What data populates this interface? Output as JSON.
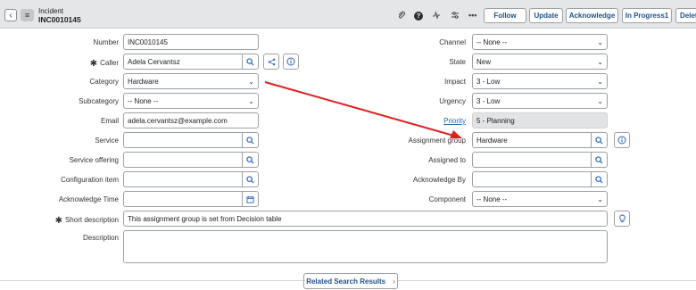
{
  "header": {
    "record_type": "Incident",
    "record_number": "INC0010145",
    "buttons": {
      "follow": "Follow",
      "update": "Update",
      "acknowledge": "Acknowledge",
      "in_progress": "In Progress1",
      "delete": "Delete"
    },
    "icons": [
      "back-icon",
      "menu-icon",
      "attachment-icon",
      "help-icon",
      "activity-icon",
      "settings-icon",
      "more-icon"
    ]
  },
  "left": {
    "number": {
      "label": "Number",
      "value": "INC0010145"
    },
    "caller": {
      "label": "Caller",
      "value": "Adela Cervantsz"
    },
    "category": {
      "label": "Category",
      "value": "Hardware"
    },
    "subcategory": {
      "label": "Subcategory",
      "value": "-- None --"
    },
    "email": {
      "label": "Email",
      "value": "adela.cervantsz@example.com"
    },
    "service": {
      "label": "Service",
      "value": ""
    },
    "service_offering": {
      "label": "Service offering",
      "value": ""
    },
    "configuration_item": {
      "label": "Configuration item",
      "value": ""
    },
    "acknowledge_time": {
      "label": "Acknowledge Time",
      "value": ""
    }
  },
  "right": {
    "channel": {
      "label": "Channel",
      "value": "-- None --"
    },
    "state": {
      "label": "State",
      "value": "New"
    },
    "impact": {
      "label": "Impact",
      "value": "3 - Low"
    },
    "urgency": {
      "label": "Urgency",
      "value": "3 - Low"
    },
    "priority": {
      "label": "Priority",
      "value": "5 - Planning"
    },
    "assignment_group": {
      "label": "Assignment group",
      "value": "Hardware"
    },
    "assigned_to": {
      "label": "Assigned to",
      "value": ""
    },
    "acknowledge_by": {
      "label": "Acknowledge By",
      "value": ""
    },
    "component": {
      "label": "Component",
      "value": "-- None --"
    }
  },
  "short_description": {
    "label": "Short description",
    "value": "This assignment group is set from Decision table"
  },
  "description": {
    "label": "Description",
    "value": ""
  },
  "related_button": "Related Search Results",
  "colors": {
    "accent": "#1f4f8a",
    "arrow": "#e02020",
    "header_bg": "#e4e6e7"
  }
}
